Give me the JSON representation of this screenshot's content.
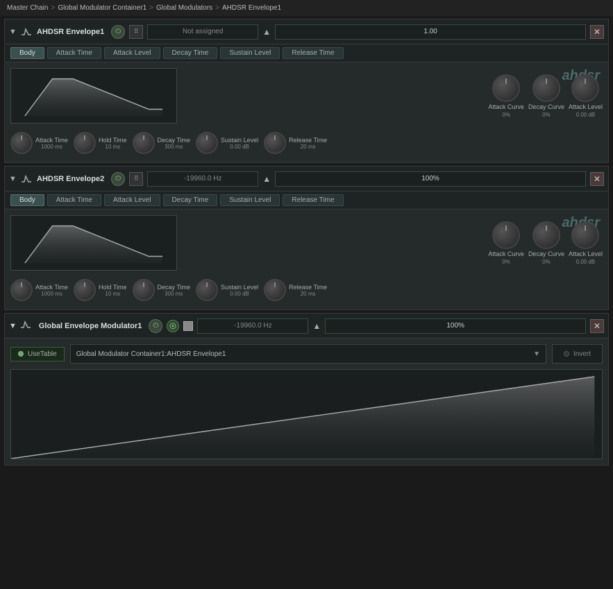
{
  "breadcrumb": {
    "items": [
      "Master Chain",
      "Global Modulator Container1",
      "Global Modulators",
      "AHDSR Envelope1"
    ]
  },
  "envelope1": {
    "title": "AHDSR Envelope1",
    "assign_label": "Not assigned",
    "value": "1.00",
    "tabs": [
      "Body",
      "Attack Time",
      "Attack Level",
      "Decay Time",
      "Sustain Level",
      "Release Time"
    ],
    "active_tab": "Body",
    "ahdsr_label": "ahdsr",
    "knobs": {
      "attack_curve": {
        "label": "Attack Curve",
        "value": "0%"
      },
      "decay_curve": {
        "label": "Decay Curve",
        "value": "0%"
      },
      "attack_level": {
        "label": "Attack Level",
        "value": "0.00 dB"
      }
    },
    "bottom_knobs": [
      {
        "label": "Attack Time",
        "value": "1000 ms"
      },
      {
        "label": "Hold Time",
        "value": "10 ms"
      },
      {
        "label": "Decay Time",
        "value": "300 ms"
      },
      {
        "label": "Sustain Level",
        "value": "0.00 dB"
      },
      {
        "label": "Release Time",
        "value": "20 ms"
      }
    ]
  },
  "envelope2": {
    "title": "AHDSR Envelope2",
    "assign_label": "-19960.0 Hz",
    "value": "100%",
    "tabs": [
      "Body",
      "Attack Time",
      "Attack Level",
      "Decay Time",
      "Sustain Level",
      "Release Time"
    ],
    "active_tab": "Body",
    "ahdsr_label": "ahdsr",
    "knobs": {
      "attack_curve": {
        "label": "Attack Curve",
        "value": "0%"
      },
      "decay_curve": {
        "label": "Decay Curve",
        "value": "0%"
      },
      "attack_level": {
        "label": "Attack Level",
        "value": "0.00 dB"
      }
    },
    "bottom_knobs": [
      {
        "label": "Attack Time",
        "value": "1000 ms"
      },
      {
        "label": "Hold Time",
        "value": "10 ms"
      },
      {
        "label": "Decay Time",
        "value": "300 ms"
      },
      {
        "label": "Sustain Level",
        "value": "0.00 dB"
      },
      {
        "label": "Release Time",
        "value": "20 ms"
      }
    ]
  },
  "global_mod": {
    "title": "Global Envelope Modulator1",
    "assign_label": "-19960.0 Hz",
    "value": "100%",
    "use_table_label": "UseTable",
    "source_label": "Global Modulator Container1:AHDSR Envelope1",
    "invert_label": "Invert"
  }
}
